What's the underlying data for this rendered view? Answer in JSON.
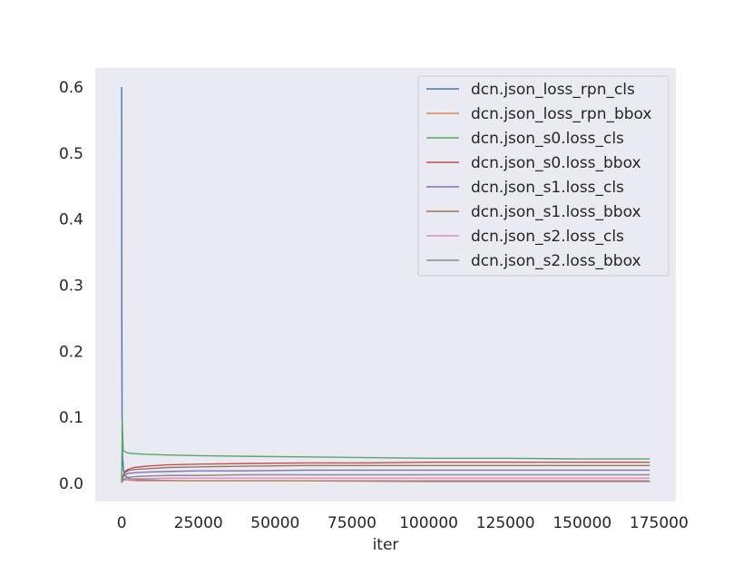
{
  "chart_data": {
    "type": "line",
    "title": "",
    "xlabel": "iter",
    "ylabel": "",
    "xlim": [
      -8600,
      180500
    ],
    "ylim": [
      -0.0275,
      0.629
    ],
    "x_ticks": [
      0,
      25000,
      50000,
      75000,
      100000,
      125000,
      150000,
      175000
    ],
    "x_tick_labels": [
      "0",
      "25000",
      "50000",
      "75000",
      "100000",
      "125000",
      "150000",
      "175000"
    ],
    "y_ticks": [
      0.0,
      0.1,
      0.2,
      0.3,
      0.4,
      0.5,
      0.6
    ],
    "y_tick_labels": [
      "0.0",
      "0.1",
      "0.2",
      "0.3",
      "0.4",
      "0.5",
      "0.6"
    ],
    "grid": false,
    "legend_position": "top-right",
    "background": "#eaeaf2",
    "series": [
      {
        "name": "dcn.json_loss_rpn_cls",
        "color": "#4c72b0",
        "x": [
          0,
          50,
          150,
          300,
          600,
          1000,
          2000,
          4000,
          8000,
          20000,
          50000,
          100000,
          150000,
          172000
        ],
        "y": [
          0.6,
          0.25,
          0.08,
          0.04,
          0.02,
          0.012,
          0.008,
          0.006,
          0.005,
          0.004,
          0.004,
          0.003,
          0.003,
          0.003
        ]
      },
      {
        "name": "dcn.json_loss_rpn_bbox",
        "color": "#dd8452",
        "x": [
          0,
          500,
          2000,
          5000,
          20000,
          50000,
          100000,
          150000,
          172000
        ],
        "y": [
          0.004,
          0.006,
          0.005,
          0.004,
          0.004,
          0.004,
          0.004,
          0.004,
          0.004
        ]
      },
      {
        "name": "dcn.json_s0.loss_cls",
        "color": "#55a868",
        "x": [
          0,
          200,
          500,
          1000,
          2000,
          4000,
          8000,
          15000,
          25000,
          40000,
          60000,
          80000,
          100000,
          125000,
          150000,
          172000
        ],
        "y": [
          0.003,
          0.095,
          0.05,
          0.048,
          0.046,
          0.045,
          0.044,
          0.043,
          0.042,
          0.041,
          0.04,
          0.039,
          0.038,
          0.038,
          0.037,
          0.037
        ]
      },
      {
        "name": "dcn.json_s0.loss_bbox",
        "color": "#c44e52",
        "x": [
          0,
          500,
          1000,
          2000,
          4000,
          8000,
          15000,
          25000,
          40000,
          60000,
          80000,
          100000,
          125000,
          150000,
          172000
        ],
        "y": [
          0.002,
          0.012,
          0.018,
          0.021,
          0.024,
          0.026,
          0.028,
          0.029,
          0.03,
          0.031,
          0.031,
          0.032,
          0.032,
          0.032,
          0.032
        ]
      },
      {
        "name": "dcn.json_s1.loss_cls",
        "color": "#8172b3",
        "x": [
          0,
          500,
          1000,
          2000,
          4000,
          8000,
          15000,
          25000,
          40000,
          60000,
          80000,
          100000,
          125000,
          150000,
          172000
        ],
        "y": [
          0.002,
          0.01,
          0.013,
          0.015,
          0.016,
          0.017,
          0.018,
          0.019,
          0.019,
          0.02,
          0.02,
          0.02,
          0.02,
          0.02,
          0.02
        ]
      },
      {
        "name": "dcn.json_s1.loss_bbox",
        "color": "#937860",
        "x": [
          0,
          500,
          1000,
          2000,
          4000,
          8000,
          15000,
          25000,
          40000,
          60000,
          80000,
          100000,
          125000,
          150000,
          172000
        ],
        "y": [
          0.001,
          0.012,
          0.016,
          0.019,
          0.021,
          0.022,
          0.024,
          0.025,
          0.026,
          0.027,
          0.027,
          0.027,
          0.027,
          0.027,
          0.027
        ]
      },
      {
        "name": "dcn.json_s2.loss_cls",
        "color": "#da8bc3",
        "x": [
          0,
          500,
          1000,
          2000,
          4000,
          8000,
          15000,
          25000,
          40000,
          60000,
          80000,
          100000,
          125000,
          150000,
          172000
        ],
        "y": [
          0.001,
          0.004,
          0.005,
          0.006,
          0.007,
          0.007,
          0.008,
          0.008,
          0.008,
          0.008,
          0.008,
          0.008,
          0.008,
          0.008,
          0.008
        ]
      },
      {
        "name": "dcn.json_s2.loss_bbox",
        "color": "#8c8c8c",
        "x": [
          0,
          500,
          1000,
          2000,
          4000,
          8000,
          15000,
          25000,
          40000,
          60000,
          80000,
          100000,
          125000,
          150000,
          172000
        ],
        "y": [
          0.001,
          0.005,
          0.007,
          0.009,
          0.01,
          0.011,
          0.012,
          0.012,
          0.013,
          0.013,
          0.013,
          0.013,
          0.013,
          0.013,
          0.013
        ]
      }
    ]
  }
}
